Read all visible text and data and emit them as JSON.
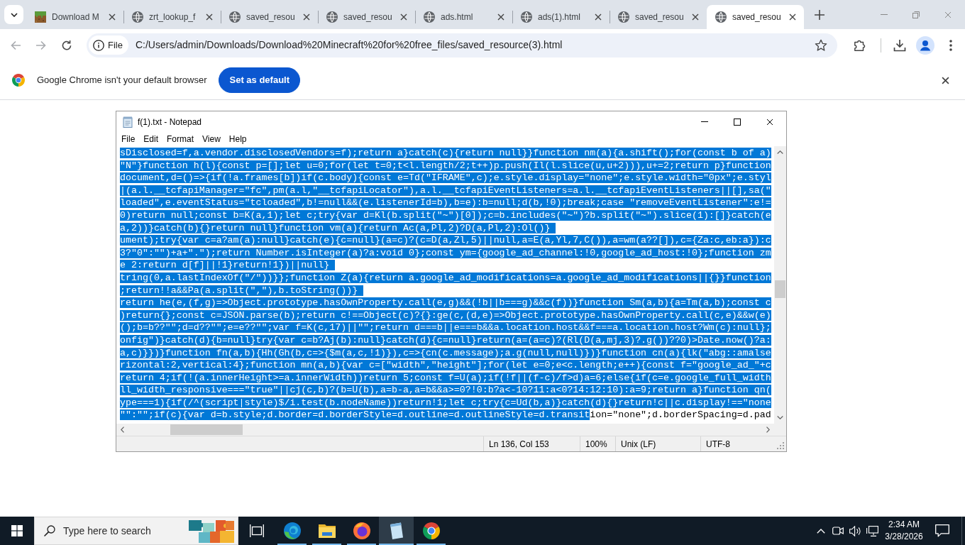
{
  "browser": {
    "tabs": [
      {
        "title": "Download M",
        "kind": "block",
        "selected": false
      },
      {
        "title": "zrt_lookup_f",
        "kind": "globe",
        "selected": false
      },
      {
        "title": "saved_resou",
        "kind": "globe",
        "selected": false
      },
      {
        "title": "saved_resou",
        "kind": "globe",
        "selected": false
      },
      {
        "title": "ads.html",
        "kind": "globe",
        "selected": false
      },
      {
        "title": "ads(1).html",
        "kind": "globe",
        "selected": false
      },
      {
        "title": "saved_resou",
        "kind": "globe",
        "selected": false
      },
      {
        "title": "saved_resou",
        "kind": "globe",
        "selected": true
      }
    ],
    "nav": [
      {
        "kind": "back",
        "disabled": true
      },
      {
        "kind": "forward",
        "disabled": true
      },
      {
        "kind": "reload",
        "disabled": false
      }
    ],
    "omnibox": {
      "chip": "File",
      "url": "C:/Users/admin/Downloads/Download%20Minecraft%20for%20free_files/saved_resource(3).html"
    },
    "infobar": {
      "message": "Google Chrome isn't your default browser",
      "button": "Set as default"
    }
  },
  "notepad": {
    "title": "f(1).txt - Notepad",
    "menu": [
      "File",
      "Edit",
      "Format",
      "View",
      "Help"
    ],
    "lines": [
      {
        "segments": [
          {
            "text": "sDisclosed=f,a.vendor.disclosedVendors=f);return a}catch(c){return null}}function nm(a){a.shift();for(const b of a)",
            "selected": true
          }
        ]
      },
      {
        "segments": [
          {
            "text": "\"N\"}function h(l){const p=[];let u=0;for(let t=0;t<l.length/2;t++)p.push(Il(l.slice(u,u+2))),u+=2;return p}function",
            "selected": true
          }
        ]
      },
      {
        "segments": [
          {
            "text": "document,d=()=>{if(!a.frames[b])if(c.body){const e=Td(\"IFRAME\",c);e.style.display=\"none\";e.style.width=\"0px\";e.styl",
            "selected": true
          }
        ]
      },
      {
        "segments": [
          {
            "text": "|(a.l.__tcfapiManager=\"fc\",pm(a.l,\"__tcfapiLocator\"),a.l.__tcfapiEventListeners=a.l.__tcfapiEventListeners||[],sa(\"",
            "selected": true
          }
        ]
      },
      {
        "segments": [
          {
            "text": "loaded\",e.eventStatus=\"tcloaded\",b!=null&&(e.listenerId=b),b=e):b=null;d(b,!0);break;case \"removeEventListener\":e!=",
            "selected": true
          }
        ]
      },
      {
        "segments": [
          {
            "text": "0)return null;const b=K(a,1);let c;try{var d=Kl(b.split(\"~\")[0]);c=b.includes(\"~\")?b.split(\"~\").slice(1):[]}catch(e",
            "selected": true
          }
        ]
      },
      {
        "segments": [
          {
            "text": "a,2))}catch(b){}return null}function vm(a){return Ac(a,Pl,2)?D(a,Pl,2):Ol()}",
            "selected": true
          }
        ]
      },
      {
        "segments": [
          {
            "text": "ument);try{var c=a?am(a):null}catch(e){c=null}(a=c)?(c=D(a,Zl,5)||null,a=E(a,Yl,7,C()),a=wm(a??[]),c={Za:c,eb:a}):c",
            "selected": true
          }
        ]
      },
      {
        "segments": [
          {
            "text": "3?\"0\":\"\")+a+\".\");return Number.isInteger(a)?a:void 0};const ym={google_ad_channel:!0,google_ad_host:!0};function zm",
            "selected": true
          }
        ]
      },
      {
        "segments": [
          {
            "text": "e 2:return d[f]||!1}return!1})||null}",
            "selected": true
          }
        ]
      },
      {
        "segments": [
          {
            "text": "tring(0,a.lastIndexOf(\"/\"))}};function Z(a){return a.google_ad_modifications=a.google_ad_modifications||{}}function",
            "selected": true
          }
        ]
      },
      {
        "segments": [
          {
            "text": ";return!!a&&Pa(a.split(\",\"),b.toString())}",
            "selected": true
          }
        ]
      },
      {
        "segments": [
          {
            "text": "return he(e,(f,g)=>Object.prototype.hasOwnProperty.call(e,g)&&(!b||b===g)&&c(f))}function Sm(a,b){a=Tm(a,b);const c",
            "selected": true
          }
        ]
      },
      {
        "segments": [
          {
            "text": ")return{};const c=JSON.parse(b);return c!==Object(c)?{}:ge(c,(d,e)=>Object.prototype.hasOwnProperty.call(c,e)&&w(e)",
            "selected": true
          }
        ]
      },
      {
        "segments": [
          {
            "text": "();b=b??\"\";d=d??\"\";e=e??\"\";var f=K(c,17)||\"\";return d===b||e===b&&a.location.host&&f===a.location.host?Wm(c):null};",
            "selected": true
          }
        ]
      },
      {
        "segments": [
          {
            "text": "onfig\")}catch(d){b=null}try{var c=b?Aj(b):null}catch(d){c=null}return(a=(a=c)?(Rl(D(a,mj,3)?.g())??0)>Date.now()?a:",
            "selected": true
          }
        ]
      },
      {
        "segments": [
          {
            "text": "a,c)}})}function fn(a,b){Hh(Gh(b,c=>{$m(a,c,!1)}),c=>{cn(c.message);a.g(null,null)})}function cn(a){lk(\"abg::amalse",
            "selected": true
          }
        ]
      },
      {
        "segments": [
          {
            "text": "rizontal:2,vertical:4};function mn(a,b){var c=[\"width\",\"height\"];for(let e=0;e<c.length;e++){const f=\"google_ad_\"+c",
            "selected": true
          }
        ]
      },
      {
        "segments": [
          {
            "text": "return 4;if(!(a.innerHeight>=a.innerWidth))return 5;const f=U(a);if(!f||(f-c)/f>d)a=6;else{if(c=e.google_full_width",
            "selected": true
          }
        ]
      },
      {
        "segments": [
          {
            "text": "ll_width_responsive===\"true\"||cj(c,b)?(b=U(b),a=b-a,a=b&&a>=0?!0:b?a<-10?11:a<0?14:12:10):a=9;return a}function qn(",
            "selected": true
          }
        ]
      },
      {
        "segments": [
          {
            "text": "ype===1){if(/^(script|style)$/i.test(b.nodeName))return!1;let c;try{c=Ud(b,a)}catch(d){}return!c||c.display!==\"none",
            "selected": true
          }
        ]
      },
      {
        "segments": [
          {
            "text": "\"\":\"\";if(c){var d=b.style;d.border=d.borderStyle=d.outline=d.outlineStyle=d.transit",
            "selected": true
          },
          {
            "text": "ion=\"none\";d.borderSpacing=d.pad",
            "selected": false
          }
        ]
      }
    ],
    "status": [
      "Ln 136, Col 153",
      "100%",
      "Unix (LF)",
      "UTF-8"
    ]
  },
  "taskbar": {
    "search": {
      "placeholder": "Type here to search"
    },
    "apps": [
      {
        "kind": "edge",
        "running": true,
        "selected": false
      },
      {
        "kind": "explorer",
        "running": true,
        "selected": false
      },
      {
        "kind": "firefox",
        "running": true,
        "selected": false
      },
      {
        "kind": "notepad",
        "running": true,
        "selected": true
      },
      {
        "kind": "chrome",
        "running": true,
        "selected": false
      }
    ],
    "time": "2:34 AM",
    "date": "3/28/2026"
  }
}
